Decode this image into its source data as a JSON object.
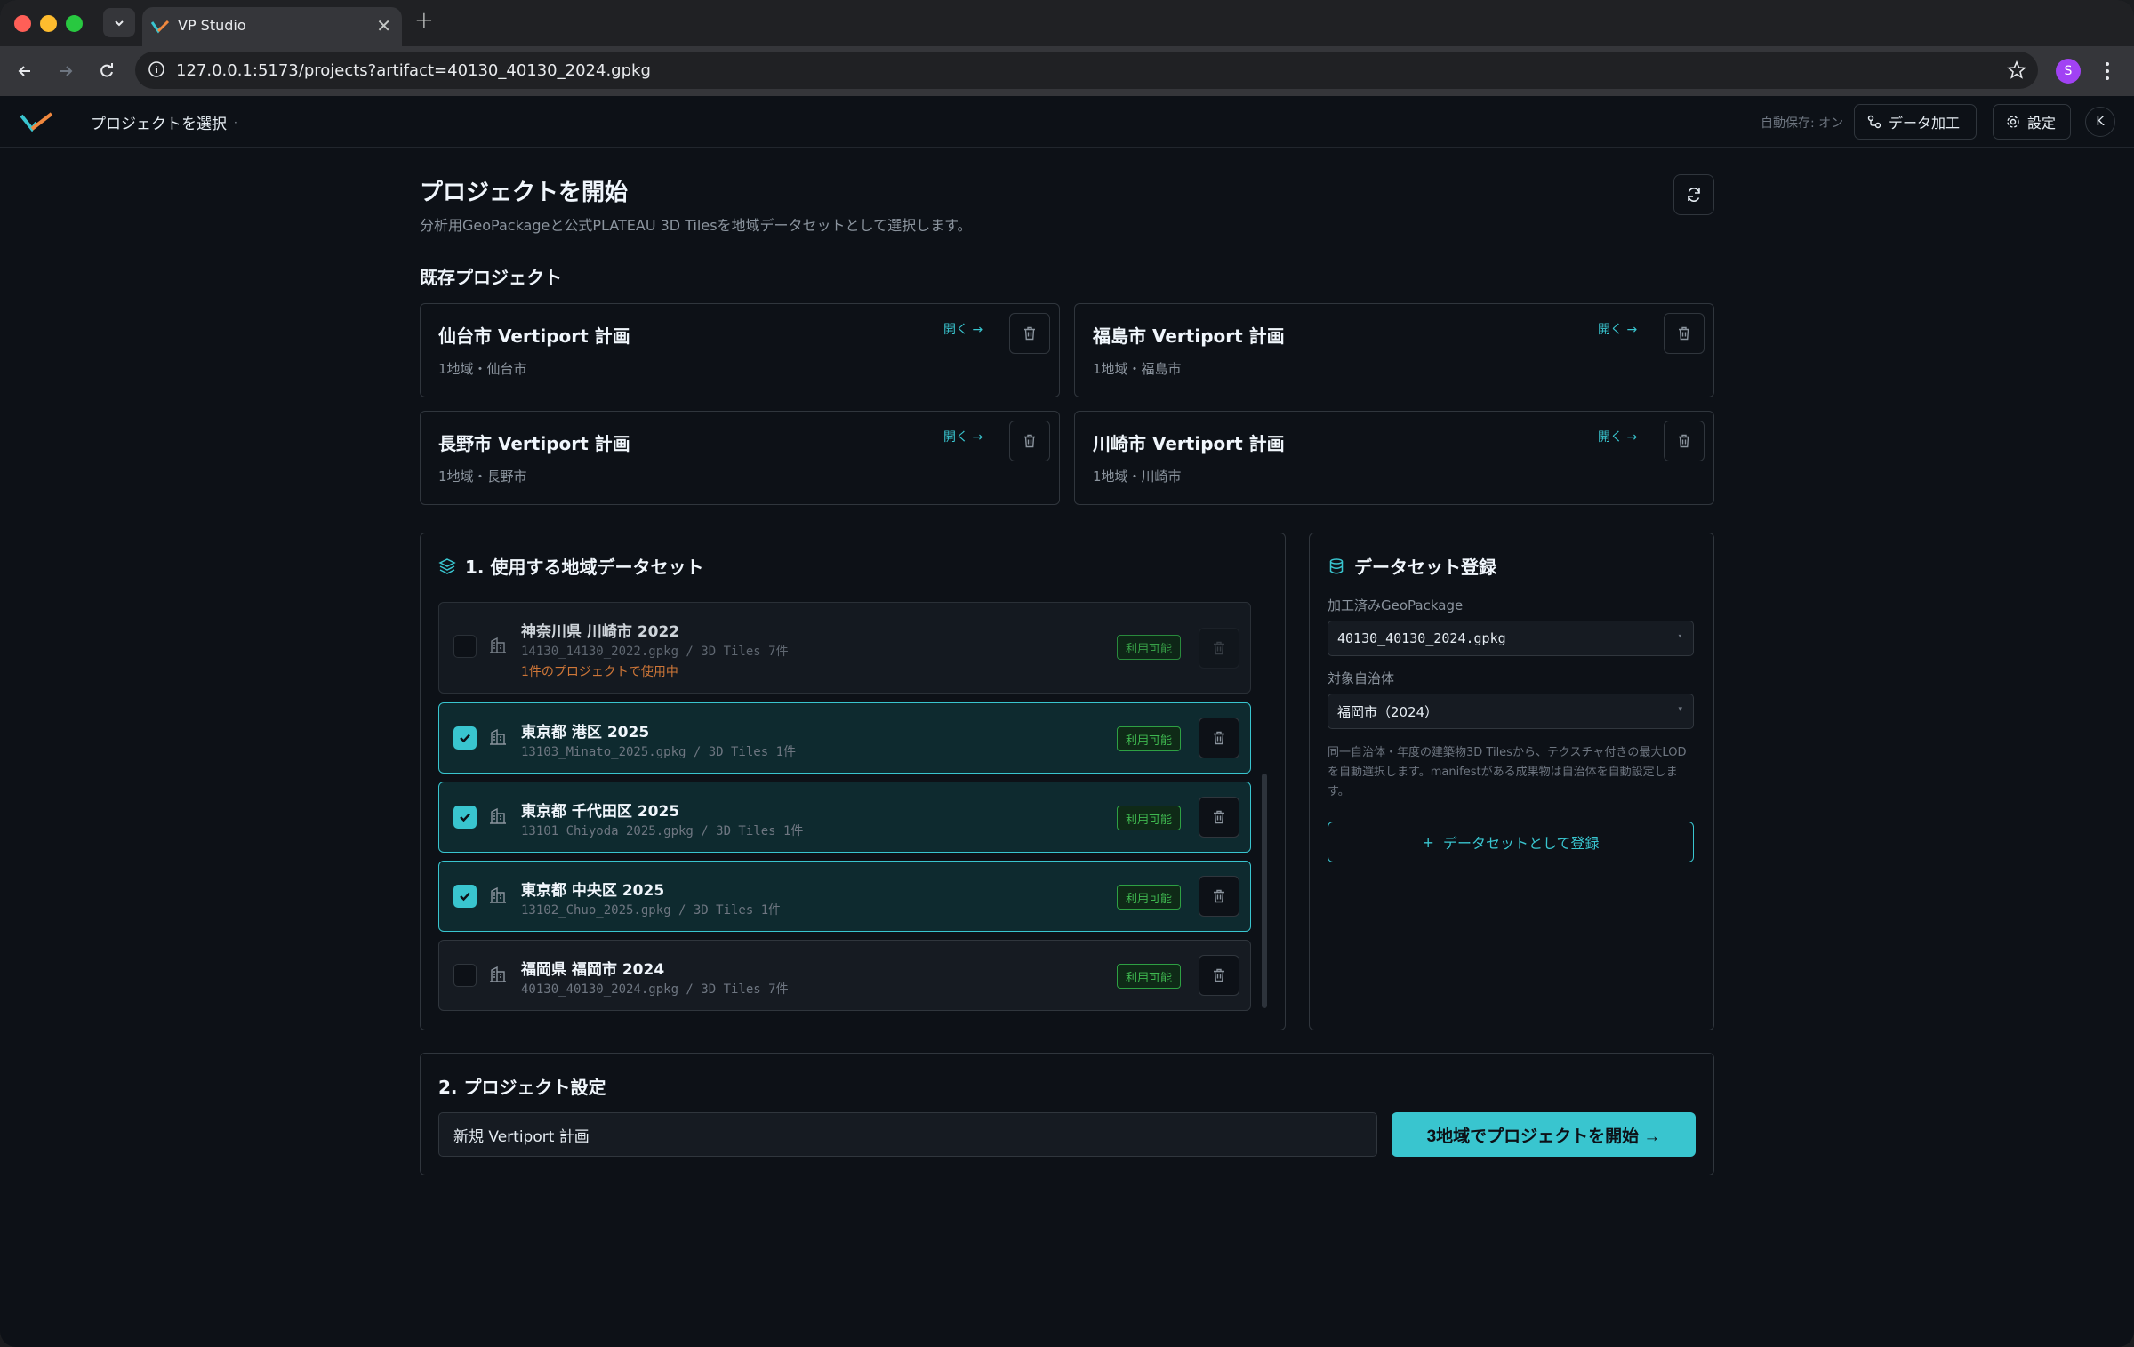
{
  "browser": {
    "tab_title": "VP Studio",
    "tab_close": "✕",
    "new_tab": "+",
    "url": "127.0.0.1:5173/projects?artifact=40130_40130_2024.gpkg",
    "profile_initial": "S"
  },
  "header": {
    "project_select_label": "プロジェクトを選択",
    "project_select_chevron": "·",
    "autosave": "自動保存: オン",
    "data_processing_label": "データ加工",
    "settings_label": "設定",
    "user_initial": "K"
  },
  "page": {
    "title": "プロジェクトを開始",
    "subtitle": "分析用GeoPackageと公式PLATEAU 3D Tilesを地域データセットとして選択します。",
    "existing_heading": "既存プロジェクト"
  },
  "projects": [
    {
      "name": "仙台市 Vertiport 計画",
      "meta": "1地域・仙台市",
      "open_label": "開く →"
    },
    {
      "name": "福島市 Vertiport 計画",
      "meta": "1地域・福島市",
      "open_label": "開く →"
    },
    {
      "name": "長野市 Vertiport 計画",
      "meta": "1地域・長野市",
      "open_label": "開く →"
    },
    {
      "name": "川崎市 Vertiport 計画",
      "meta": "1地域・川崎市",
      "open_label": "開く →"
    }
  ],
  "datasets_panel": {
    "heading": "1. 使用する地域データセット",
    "items": [
      {
        "name": "神奈川県 川崎市 2022",
        "file": "14130_14130_2022.gpkg / 3D Tiles 7件",
        "warning": "1件のプロジェクトで使用中",
        "badge": "利用可能",
        "selected": false
      },
      {
        "name": "東京都 港区 2025",
        "file": "13103_Minato_2025.gpkg / 3D Tiles 1件",
        "badge": "利用可能",
        "selected": true
      },
      {
        "name": "東京都 千代田区 2025",
        "file": "13101_Chiyoda_2025.gpkg / 3D Tiles 1件",
        "badge": "利用可能",
        "selected": true
      },
      {
        "name": "東京都 中央区 2025",
        "file": "13102_Chuo_2025.gpkg / 3D Tiles 1件",
        "badge": "利用可能",
        "selected": true
      },
      {
        "name": "福岡県 福岡市 2024",
        "file": "40130_40130_2024.gpkg / 3D Tiles 7件",
        "badge": "利用可能",
        "selected": false
      }
    ]
  },
  "register_panel": {
    "heading": "データセット登録",
    "gpkg_label": "加工済みGeoPackage",
    "gpkg_value": "40130_40130_2024.gpkg",
    "municipality_label": "対象自治体",
    "municipality_value": "福岡市（2024）",
    "help": "同一自治体・年度の建築物3D Tilesから、テクスチャ付きの最大LODを自動選択します。manifestがある成果物は自治体を自動設定します。",
    "register_label": "データセットとして登録"
  },
  "settings_panel": {
    "heading": "2. プロジェクト設定",
    "name_value": "新規 Vertiport 計画",
    "start_label": "3地域でプロジェクトを開始 →"
  },
  "colors": {
    "accent": "#39c5cf",
    "available": "#3fb950",
    "warning": "#f0883e",
    "background": "#0d1117"
  }
}
